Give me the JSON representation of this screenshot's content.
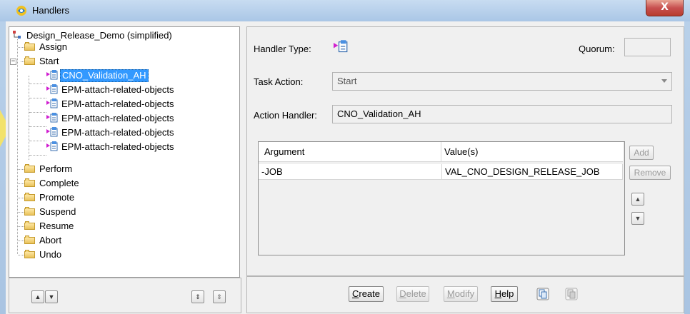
{
  "window": {
    "title": "Handlers",
    "close_glyph": "X"
  },
  "tree": {
    "root": "Design_Release_Demo (simplified)",
    "items": [
      {
        "label": "Assign",
        "type": "folder"
      },
      {
        "label": "Start",
        "type": "folder",
        "expanded": true
      },
      {
        "label": "CNO_Validation_AH",
        "type": "handler",
        "selected": true
      },
      {
        "label": "EPM-attach-related-objects",
        "type": "handler"
      },
      {
        "label": "EPM-attach-related-objects",
        "type": "handler"
      },
      {
        "label": "EPM-attach-related-objects",
        "type": "handler"
      },
      {
        "label": "EPM-attach-related-objects",
        "type": "handler"
      },
      {
        "label": "EPM-attach-related-objects",
        "type": "handler"
      },
      {
        "label": "Perform",
        "type": "folder"
      },
      {
        "label": "Complete",
        "type": "folder"
      },
      {
        "label": "Promote",
        "type": "folder"
      },
      {
        "label": "Suspend",
        "type": "folder"
      },
      {
        "label": "Resume",
        "type": "folder"
      },
      {
        "label": "Abort",
        "type": "folder"
      },
      {
        "label": "Undo",
        "type": "folder"
      }
    ]
  },
  "form": {
    "handler_type_label": "Handler Type:",
    "quorum_label": "Quorum:",
    "quorum_value": "",
    "task_action_label": "Task Action:",
    "task_action_value": "Start",
    "action_handler_label": "Action Handler:",
    "action_handler_value": "CNO_Validation_AH"
  },
  "arguments": {
    "headers": [
      "Argument",
      "Value(s)"
    ],
    "rows": [
      {
        "argument": "-JOB",
        "value": "VAL_CNO_DESIGN_RELEASE_JOB"
      }
    ]
  },
  "side_buttons": {
    "add": "Add",
    "remove": "Remove"
  },
  "bottom_buttons": {
    "create": "Create",
    "delete": "Delete",
    "modify": "Modify",
    "help": "Help"
  },
  "colors": {
    "selection": "#3399ff",
    "titlebar": "#aac6e6",
    "close": "#c75050"
  }
}
